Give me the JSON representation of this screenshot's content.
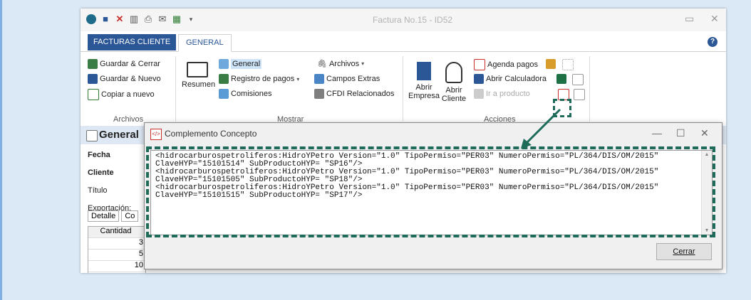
{
  "window": {
    "title": "Factura No.15 - ID52"
  },
  "tabs": {
    "facturas": "FACTURAS CLIENTE",
    "general": "GENERAL"
  },
  "ribbon": {
    "archivos": {
      "items": [
        "Guardar & Cerrar",
        "Guardar & Nuevo",
        "Copiar a nuevo"
      ],
      "group_label": "Archivos"
    },
    "mostrar": {
      "resumen": "Resumen",
      "general": "General",
      "registro_pagos": "Registro de pagos",
      "comisiones": "Comisiones",
      "archivos": "Archivos",
      "campos_extras": "Campos Extras",
      "cfdi": "CFDI Relacionados",
      "group_label": "Mostrar"
    },
    "acciones": {
      "abrir_empresa_1": "Abrir",
      "abrir_empresa_2": "Empresa",
      "abrir_cliente_1": "Abrir",
      "abrir_cliente_2": "Cliente",
      "agenda": "Agenda pagos",
      "calculadora": "Abrir Calculadora",
      "ir_producto": "Ir a producto",
      "group_label": "Acciones"
    }
  },
  "form": {
    "section_title": "General",
    "fecha": "Fecha",
    "cliente": "Cliente",
    "titulo": "Título",
    "exportacion": "Exportación:",
    "tab_detalle": "Detalle",
    "tab_co": "Co",
    "col_cantidad": "Cantidad",
    "rows": [
      "3",
      "5",
      "10"
    ]
  },
  "dialog": {
    "title": "Complemento Concepto",
    "content": "<hidrocarburospetroliferos:HidroYPetro Version=\"1.0\" TipoPermiso=\"PER03\" NumeroPermiso=\"PL/364/DIS/OM/2015\"\nClaveHYP=\"15101514\" SubProductoHYP= \"SP16\"/>\n<hidrocarburospetroliferos:HidroYPetro Version=\"1.0\" TipoPermiso=\"PER03\" NumeroPermiso=\"PL/364/DIS/OM/2015\"\nClaveHYP=\"15101505\" SubProductoHYP= \"SP18\"/>\n<hidrocarburospetroliferos:HidroYPetro Version=\"1.0\" TipoPermiso=\"PER03\" NumeroPermiso=\"PL/364/DIS/OM/2015\"\nClaveHYP=\"15101515\" SubProductoHYP= \"SP17\"/>",
    "close_button": "Cerrar"
  },
  "icons": {
    "dialog_icon": "complemento-icon"
  },
  "colors": {
    "accent": "#2b5797",
    "highlight": "#1f6b5a"
  }
}
